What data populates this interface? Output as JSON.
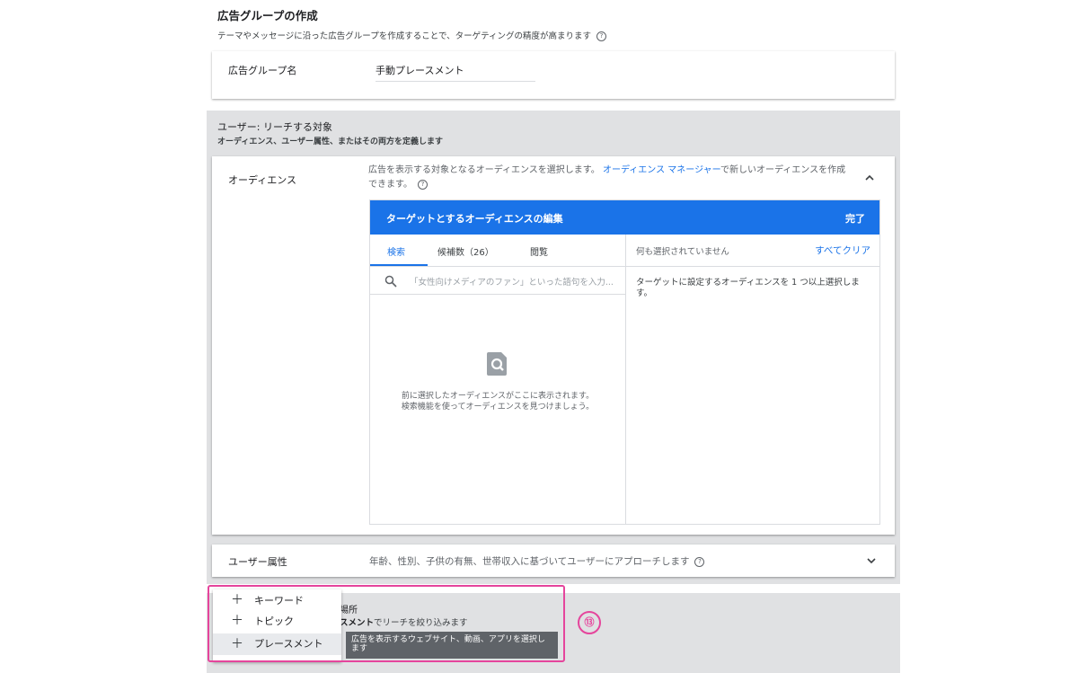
{
  "header": {
    "title": "広告グループの作成",
    "subtitle": "テーマやメッセージに沿った広告グループを作成することで、ターゲティングの精度が高まります",
    "help_glyph": "?"
  },
  "adgroup": {
    "label": "広告グループ名",
    "value": "手動プレースメント"
  },
  "users_section": {
    "title": "ユーザー: リーチする対象",
    "subtitle": "オーディエンス、ユーザー属性、またはその両方を定義します"
  },
  "audience": {
    "label": "オーディエンス",
    "desc_prefix": "広告を表示する対象となるオーディエンスを選択します。",
    "desc_link": "オーディエンス マネージャー",
    "desc_suffix": "で新しいオーディエンスを作成できます。",
    "help_glyph": "?",
    "editor": {
      "title": "ターゲットとするオーディエンスの編集",
      "done": "完了",
      "tabs": [
        "検索",
        "候補数（26）",
        "閲覧"
      ],
      "active_tab": 0,
      "search_placeholder": "「女性向けメディアのファン」といった語句を入力...",
      "empty_line1": "前に選択したオーディエンスがここに表示されます。",
      "empty_line2": "検索機能を使ってオーディエンスを見つけましょう。",
      "none_selected": "何も選択されていません",
      "clear_all": "すべてクリア",
      "right_hint": "ターゲットに設定するオーディエンスを 1 つ以上選択します。"
    }
  },
  "demographics": {
    "label": "ユーザー属性",
    "desc": "年齢、性別、子供の有無、世帯収入に基づいてユーザーにアプローチします",
    "help_glyph": "?"
  },
  "content_section": {
    "title_partial": "場所",
    "sub_bold": "スメント",
    "sub_rest": "でリーチを絞り込みます"
  },
  "menu": {
    "items": [
      {
        "label": "キーワード"
      },
      {
        "label": "トピック"
      },
      {
        "label": "プレースメント"
      }
    ],
    "plus_glyph": "＋"
  },
  "tooltip": {
    "text": "広告を表示するウェブサイト、動画、アプリを選択します"
  },
  "annotation": {
    "step": "⑬",
    "color": "#e5459c"
  },
  "colors": {
    "accent": "#1a73e8",
    "section_bg": "#e0e1e3"
  }
}
